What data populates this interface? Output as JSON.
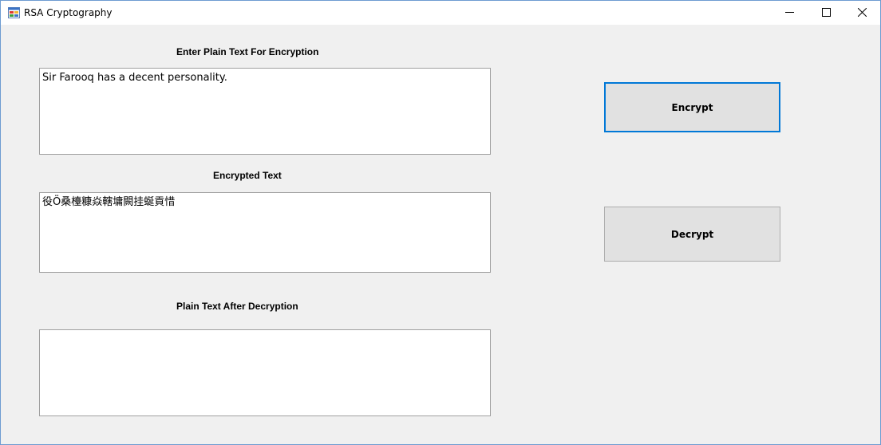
{
  "window": {
    "title": "RSA Cryptography"
  },
  "colors": {
    "accent_focus": "#0078d7",
    "button_bg": "#e1e1e1",
    "window_bg": "#f0f0f0"
  },
  "form": {
    "plain_label": "Enter Plain Text For Encryption",
    "plain_value": "Sir Farooq has a decent personality.",
    "encrypted_label": "Encrypted Text",
    "encrypted_value": "役Ö\u0001\u0001\u0001桑\u0001\u0001\u0001\u0001檯\u0001\u0001\u0001\u0001\u0001\u0001\u0001\u0001\u0001糠\u0001焱\u0001\u0001\u0001\u0001\u0001\u0001轄\u0001\u0001\u0001\u0001\u0001\u0001\u0001\u0001\u0001\u0001\u0001\u0001\u0001\u0001墉\u0001闕\u0001\u0001挂\u0001\u0001\u0001\u0001\u0001\u0001蜒\u0001\u0001\u0001\u0001\u0001\u0001\u0001貢\u0001\u0001\u0001\u0001\u0001惜\u0001\u0001\u0001",
    "decrypted_label": "Plain Text After Decryption",
    "decrypted_value": ""
  },
  "buttons": {
    "encrypt_label": "Encrypt",
    "decrypt_label": "Decrypt"
  }
}
